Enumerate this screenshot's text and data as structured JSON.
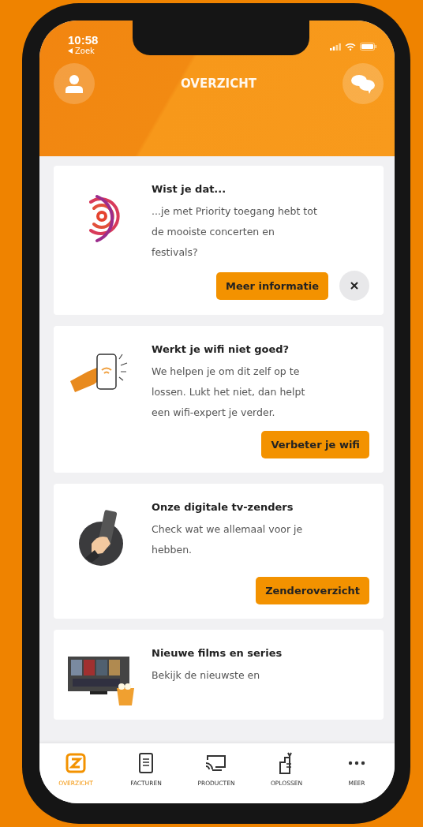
{
  "status_bar": {
    "time": "10:58",
    "back_label": "Zoek"
  },
  "header": {
    "title": "OVERZICHT"
  },
  "cards": [
    {
      "kind": "rings",
      "title": "Wist je dat...",
      "body": "...je met Priority toegang hebt tot de mooiste concerten en festivals?",
      "button": "Meer informatie",
      "dismissible": true
    },
    {
      "kind": "phone_hand",
      "title": "Werkt je wifi niet goed?",
      "body": "We helpen je om dit zelf op te lossen. Lukt het niet, dan helpt een wifi-expert je verder.",
      "button": "Verbeter je wifi",
      "dismissible": false
    },
    {
      "kind": "remote",
      "title": "Onze digitale tv-zenders",
      "body": "Check wat we allemaal voor je hebben.",
      "button": "Zenderoverzicht",
      "dismissible": false
    },
    {
      "kind": "tv",
      "title": "Nieuwe films en series",
      "body": "Bekijk de nieuwste en",
      "dismissible": false
    }
  ],
  "tab_bar": [
    {
      "label": "OVERZICHT",
      "kind": "logo",
      "selected": true
    },
    {
      "label": "FACTUREN",
      "kind": "document",
      "selected": false
    },
    {
      "label": "PRODUCTEN",
      "kind": "cast",
      "selected": false
    },
    {
      "label": "OPLOSSEN",
      "kind": "tools",
      "selected": false
    },
    {
      "label": "MEER",
      "kind": "more",
      "selected": false
    }
  ]
}
